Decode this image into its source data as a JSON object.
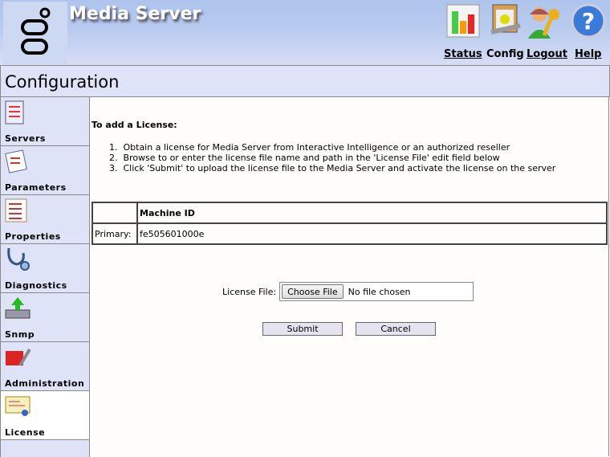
{
  "header": {
    "title": "Media Server",
    "nav": [
      {
        "label": "Status",
        "icon": "bar-chart-icon"
      },
      {
        "label": "Config",
        "icon": "clipboard-wrench-icon"
      },
      {
        "label": "Logout",
        "icon": "user-key-icon"
      },
      {
        "label": "Help",
        "icon": "help-icon"
      }
    ]
  },
  "section_title": "Configuration",
  "sidebar": {
    "items": [
      {
        "label": "Servers"
      },
      {
        "label": "Parameters"
      },
      {
        "label": "Properties"
      },
      {
        "label": "Diagnostics"
      },
      {
        "label": "Snmp"
      },
      {
        "label": "Administration"
      },
      {
        "label": "License"
      }
    ]
  },
  "main": {
    "intro": "To add a License:",
    "steps": [
      "1.  Obtain a license for Media Server from Interactive Intelligence or an authorized reseller",
      "2.  Browse to or enter the license file name and path in the 'License File' edit field below",
      "3.  Click 'Submit' to upload the license file to the Media Server and activate the license on the server"
    ],
    "table": {
      "header": "Machine ID",
      "row_label": "Primary:",
      "row_value": "fe505601000e"
    },
    "file_label": "License File:",
    "choose_label": "Choose File",
    "no_file": "No file chosen",
    "submit": "Submit",
    "cancel": "Cancel"
  }
}
